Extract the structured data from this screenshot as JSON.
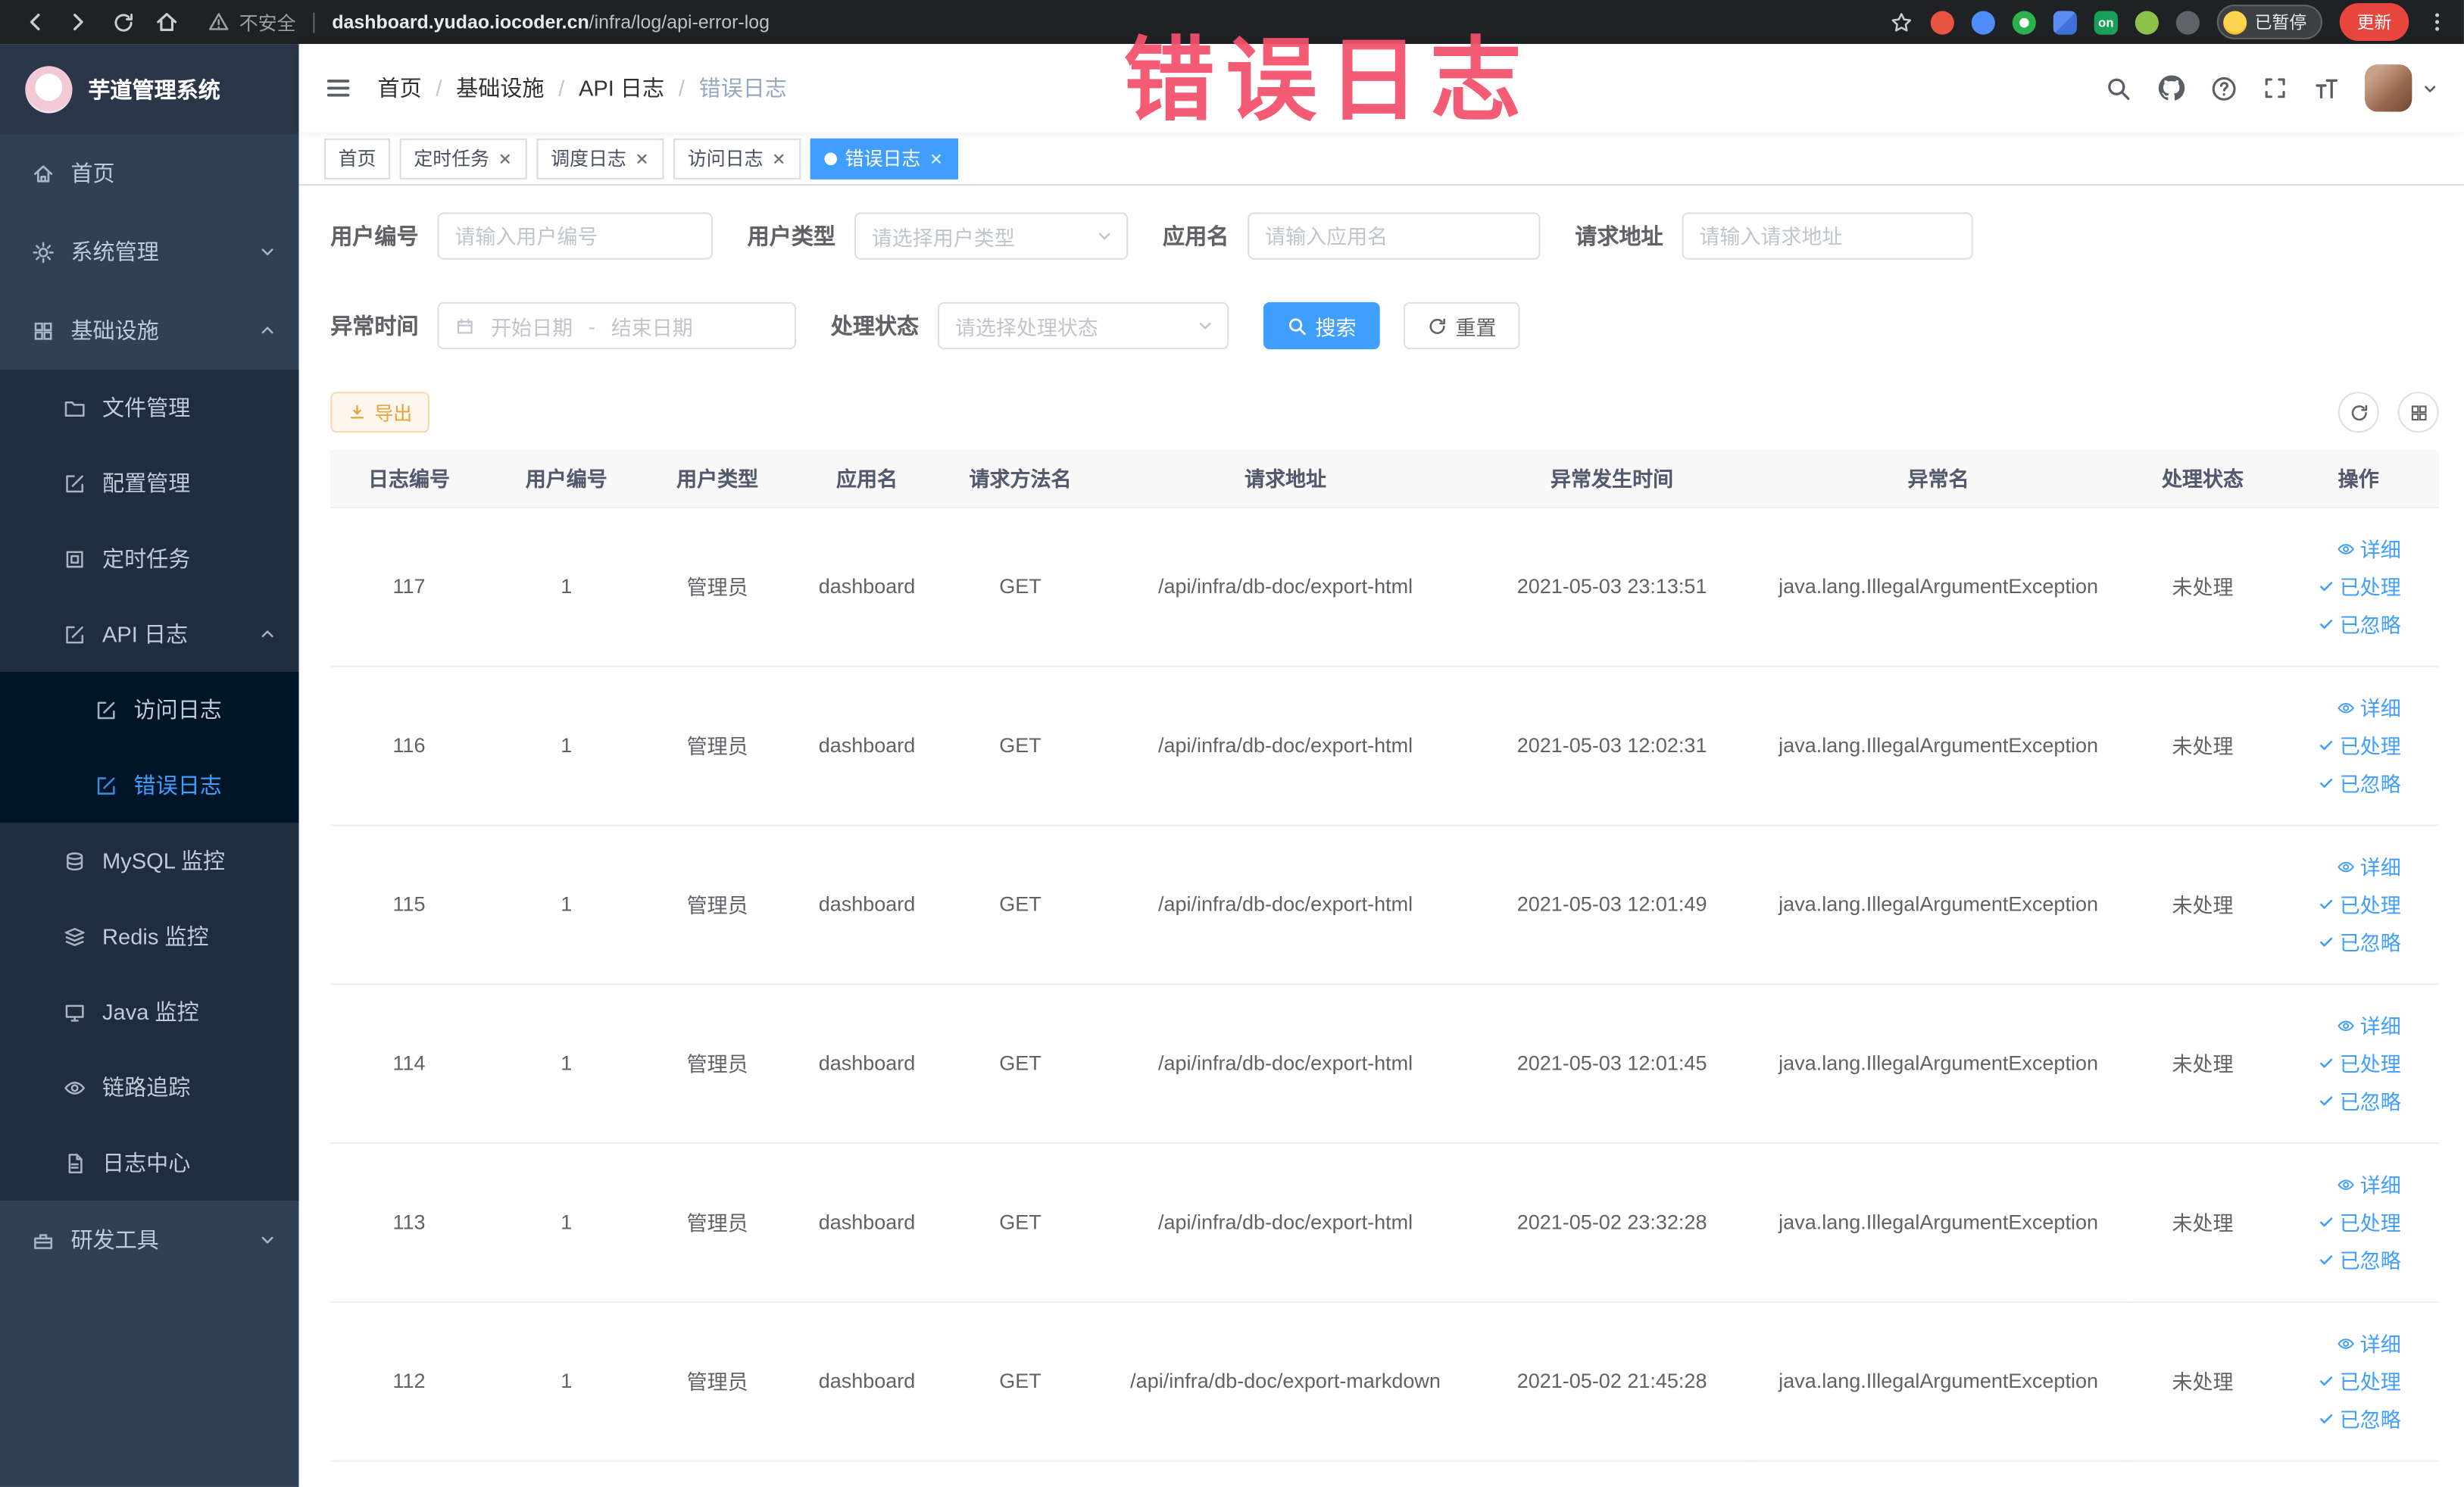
{
  "watermark": "错误日志",
  "browser": {
    "security_label": "不安全",
    "url_domain": "dashboard.yudao.iocoder.cn",
    "url_path": "/infra/log/api-error-log",
    "on_badge": "on",
    "paused_badge": "已暂停",
    "update_label": "更新"
  },
  "sidebar": {
    "logo_title": "芋道管理系统",
    "menu": {
      "home": "首页",
      "system": "系统管理",
      "infra": "基础设施",
      "file": "文件管理",
      "config": "配置管理",
      "job": "定时任务",
      "api_log": "API 日志",
      "access_log": "访问日志",
      "error_log": "错误日志",
      "mysql": "MySQL 监控",
      "redis": "Redis 监控",
      "java": "Java 监控",
      "trace": "链路追踪",
      "log_center": "日志中心",
      "dev_tools": "研发工具"
    }
  },
  "breadcrumb": {
    "separator": "/",
    "items": [
      "首页",
      "基础设施",
      "API 日志",
      "错误日志"
    ]
  },
  "tabs": [
    {
      "label": "首页"
    },
    {
      "label": "定时任务"
    },
    {
      "label": "调度日志"
    },
    {
      "label": "访问日志"
    },
    {
      "label": "错误日志"
    }
  ],
  "filters": {
    "user_id": {
      "label": "用户编号",
      "placeholder": "请输入用户编号"
    },
    "user_type": {
      "label": "用户类型",
      "placeholder": "请选择用户类型"
    },
    "app_name": {
      "label": "应用名",
      "placeholder": "请输入应用名"
    },
    "request_url": {
      "label": "请求地址",
      "placeholder": "请输入请求地址"
    },
    "exception_time": {
      "label": "异常时间",
      "start_placeholder": "开始日期",
      "separator": "-",
      "end_placeholder": "结束日期"
    },
    "process_status": {
      "label": "处理状态",
      "placeholder": "请选择处理状态"
    },
    "search_label": "搜索",
    "reset_label": "重置"
  },
  "toolbar": {
    "export_label": "导出"
  },
  "table": {
    "columns": [
      "日志编号",
      "用户编号",
      "用户类型",
      "应用名",
      "请求方法名",
      "请求地址",
      "异常发生时间",
      "异常名",
      "处理状态",
      "操作"
    ],
    "rows": [
      {
        "id": "117",
        "user_id": "1",
        "user_type": "管理员",
        "app": "dashboard",
        "method": "GET",
        "url": "/api/infra/db-doc/export-html",
        "time": "2021-05-03 23:13:51",
        "exception": "java.lang.IllegalArgumentException",
        "status": "未处理"
      },
      {
        "id": "116",
        "user_id": "1",
        "user_type": "管理员",
        "app": "dashboard",
        "method": "GET",
        "url": "/api/infra/db-doc/export-html",
        "time": "2021-05-03 12:02:31",
        "exception": "java.lang.IllegalArgumentException",
        "status": "未处理"
      },
      {
        "id": "115",
        "user_id": "1",
        "user_type": "管理员",
        "app": "dashboard",
        "method": "GET",
        "url": "/api/infra/db-doc/export-html",
        "time": "2021-05-03 12:01:49",
        "exception": "java.lang.IllegalArgumentException",
        "status": "未处理"
      },
      {
        "id": "114",
        "user_id": "1",
        "user_type": "管理员",
        "app": "dashboard",
        "method": "GET",
        "url": "/api/infra/db-doc/export-html",
        "time": "2021-05-03 12:01:45",
        "exception": "java.lang.IllegalArgumentException",
        "status": "未处理"
      },
      {
        "id": "113",
        "user_id": "1",
        "user_type": "管理员",
        "app": "dashboard",
        "method": "GET",
        "url": "/api/infra/db-doc/export-html",
        "time": "2021-05-02 23:32:28",
        "exception": "java.lang.IllegalArgumentException",
        "status": "未处理"
      },
      {
        "id": "112",
        "user_id": "1",
        "user_type": "管理员",
        "app": "dashboard",
        "method": "GET",
        "url": "/api/infra/db-doc/export-markdown",
        "time": "2021-05-02 21:45:28",
        "exception": "java.lang.IllegalArgumentException",
        "status": "未处理"
      }
    ],
    "actions": {
      "detail": "详细",
      "processed": "已处理",
      "ignored": "已忽略"
    }
  }
}
